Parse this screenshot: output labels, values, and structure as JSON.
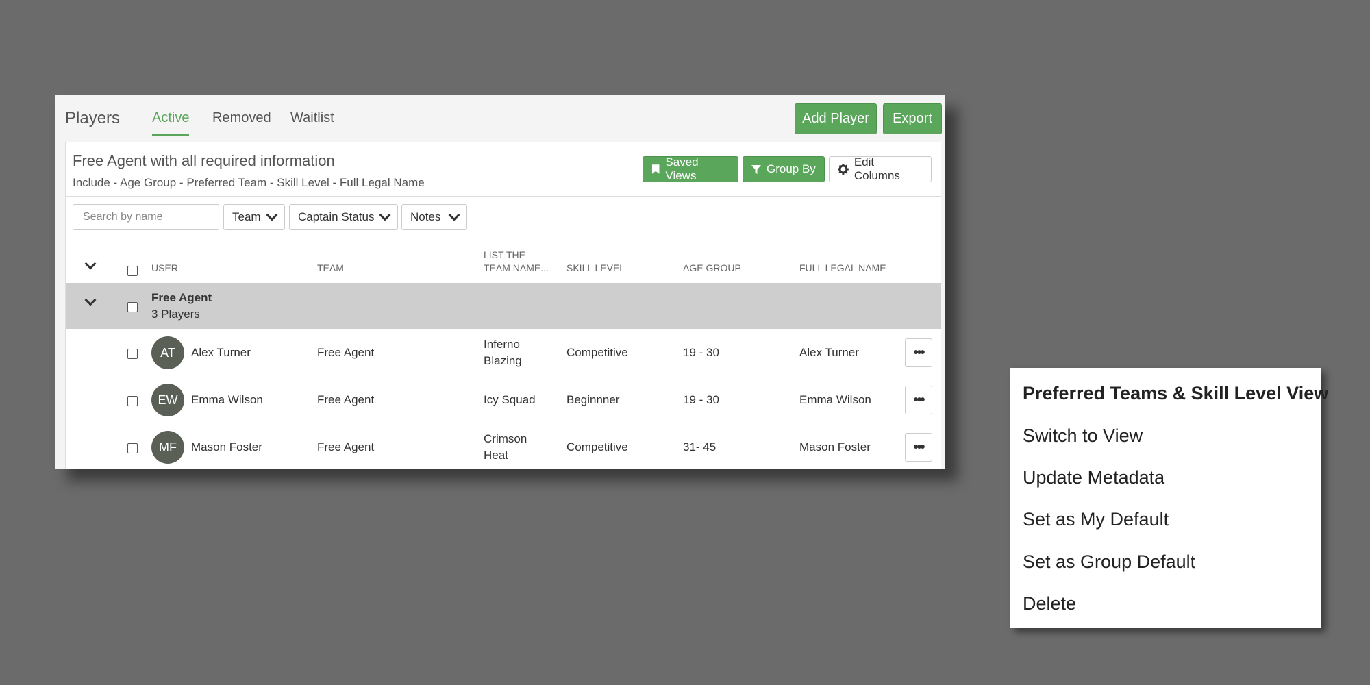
{
  "header": {
    "title": "Players",
    "tabs": [
      {
        "label": "Active"
      },
      {
        "label": "Removed"
      },
      {
        "label": "Waitlist"
      }
    ],
    "add_player_label": "Add Player",
    "export_label": "Export"
  },
  "view": {
    "title": "Free Agent with all required information",
    "subtitle": "Include - Age Group - Preferred Team - Skill Level - Full Legal Name",
    "saved_views_label": "Saved Views",
    "group_by_label": "Group By",
    "edit_columns_label": "Edit Columns"
  },
  "filters": {
    "search_placeholder": "Search by name",
    "team_label": "Team",
    "captain_status_label": "Captain Status",
    "notes_label": "Notes"
  },
  "columns": {
    "user": "USER",
    "team": "TEAM",
    "list_team_name_1": "LIST THE",
    "list_team_name_2": "TEAM NAME...",
    "skill_level": "SKILL LEVEL",
    "age_group": "AGE GROUP",
    "full_legal_name": "FULL LEGAL NAME"
  },
  "group": {
    "name": "Free Agent",
    "count": "3 Players"
  },
  "rows": [
    {
      "initials": "AT",
      "user": "Alex Turner",
      "team": "Free Agent",
      "list_team_1": "Inferno",
      "list_team_2": "Blazing",
      "skill": "Competitive",
      "age": "19 - 30",
      "legal": "Alex Turner"
    },
    {
      "initials": "EW",
      "user": "Emma Wilson",
      "team": "Free Agent",
      "list_team_1": "Icy Squad",
      "list_team_2": "",
      "skill": "Beginnner",
      "age": "19 - 30",
      "legal": "Emma Wilson"
    },
    {
      "initials": "MF",
      "user": "Mason Foster",
      "team": "Free Agent",
      "list_team_1": "Crimson",
      "list_team_2": "Heat",
      "skill": "Competitive",
      "age": "31- 45",
      "legal": "Mason Foster"
    }
  ],
  "menu": {
    "title": "Preferred Teams & Skill Level View",
    "items": [
      {
        "label": "Switch to View"
      },
      {
        "label": "Update Metadata"
      },
      {
        "label": "Set as My Default"
      },
      {
        "label": "Set as Group Default"
      },
      {
        "label": "Delete"
      }
    ]
  },
  "colors": {
    "accent_green": "#5aa65a",
    "background": "#6b6b6b",
    "group_row": "#cecece"
  }
}
